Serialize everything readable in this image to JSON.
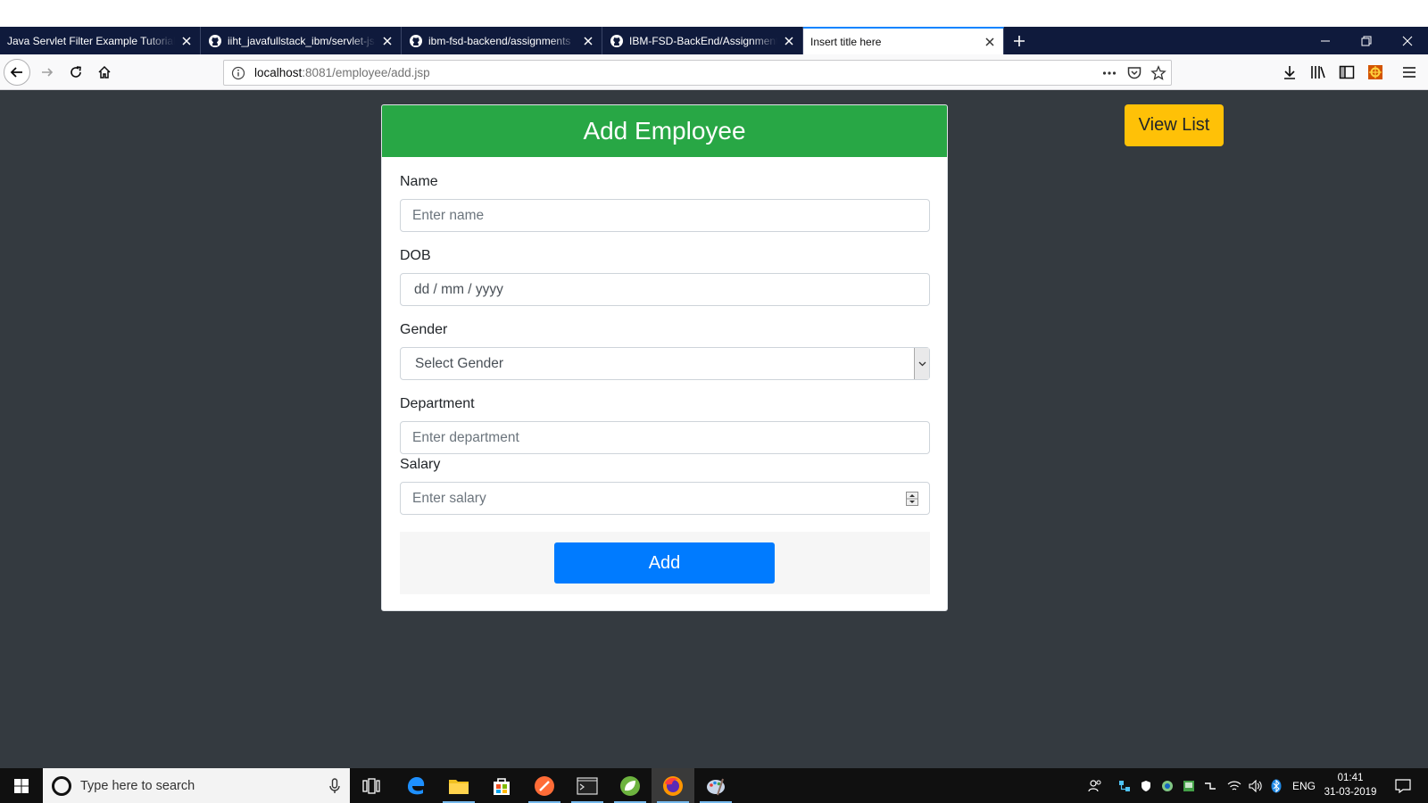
{
  "browser": {
    "tabs": [
      {
        "label": "Java Servlet Filter Example Tutorial - JournalDev",
        "has_github_icon": false,
        "active": false
      },
      {
        "label": "iiht_javafullstack_ibm/servlet-jsp",
        "has_github_icon": true,
        "active": false
      },
      {
        "label": "ibm-fsd-backend/assignments",
        "has_github_icon": true,
        "active": false
      },
      {
        "label": "IBM-FSD-BackEnd/Assignments",
        "has_github_icon": true,
        "active": false
      },
      {
        "label": "Insert title here",
        "has_github_icon": false,
        "active": true
      }
    ],
    "url_host": "localhost",
    "url_rest": ":8081/employee/add.jsp",
    "icons": {
      "back": "back-arrow-icon",
      "forward": "forward-arrow-icon",
      "reload": "reload-icon",
      "home": "home-icon",
      "page_actions": "more-dots-icon",
      "pocket": "pocket-icon",
      "bookmark": "star-icon"
    }
  },
  "form": {
    "title": "Add Employee",
    "name_label": "Name",
    "name_placeholder": "Enter name",
    "dob_label": "DOB",
    "dob_placeholder": "dd / mm / yyyy",
    "gender_label": "Gender",
    "gender_selected": "Select Gender",
    "department_label": "Department",
    "department_placeholder": "Enter department",
    "salary_label": "Salary",
    "salary_placeholder": "Enter salary",
    "submit_label": "Add"
  },
  "view_list_label": "View List",
  "colors": {
    "page_bg": "#343a40",
    "header_green": "#28a745",
    "button_blue": "#007bff",
    "button_yellow": "#ffc107",
    "tabstrip": "#0f1a3c"
  },
  "taskbar": {
    "search_placeholder": "Type here to search",
    "language": "ENG",
    "time": "01:41",
    "date": "31-03-2019"
  }
}
